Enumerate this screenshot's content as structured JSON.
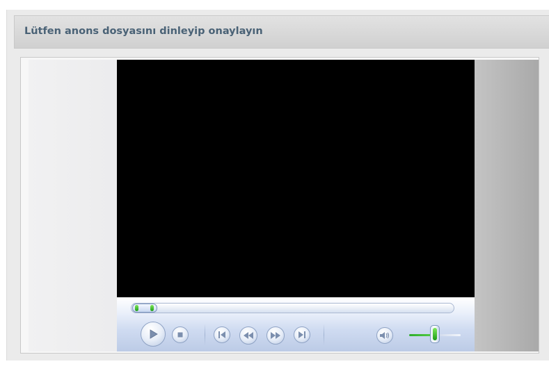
{
  "dialog": {
    "title": "Lütfen anons dosyasını dinleyip onaylayın"
  },
  "player": {
    "seek_position": 0.0,
    "volume_level": 0.55,
    "icons": {
      "play": "play-icon",
      "stop": "stop-icon",
      "previous": "previous-track-icon",
      "rewind": "rewind-icon",
      "fast_forward": "fast-forward-icon",
      "next": "next-track-icon",
      "mute": "speaker-icon"
    },
    "colors": {
      "screen": "#000000",
      "accent_green": "#2fae2a",
      "control_bar": "#cfdbf1",
      "title_text": "#4a6276"
    }
  }
}
